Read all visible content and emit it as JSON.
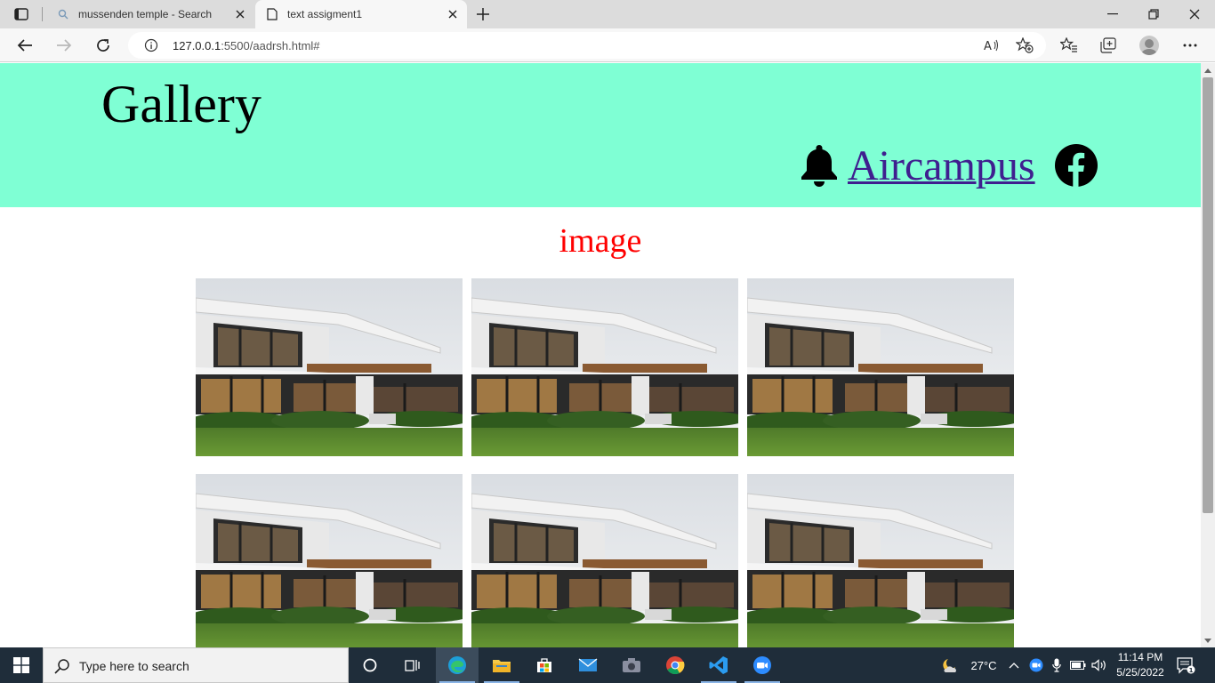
{
  "browser": {
    "tabs": [
      {
        "label": "mussenden temple - Search",
        "icon": "search-icon",
        "active": false
      },
      {
        "label": "text assigment1",
        "icon": "page-icon",
        "active": true
      }
    ],
    "address": {
      "host": "127.0.0.1",
      "rest": ":5500/aadrsh.html#"
    }
  },
  "page": {
    "header": {
      "title": "Gallery",
      "link_label": "Aircampus",
      "bg_color": "#7fffd4",
      "link_color": "#3f1f8f"
    },
    "section_title": "image",
    "section_title_color": "#ff0000",
    "images": [
      {
        "alt": "house"
      },
      {
        "alt": "house"
      },
      {
        "alt": "house"
      },
      {
        "alt": "house"
      },
      {
        "alt": "house"
      },
      {
        "alt": "house"
      }
    ]
  },
  "taskbar": {
    "search_placeholder": "Type here to search",
    "weather": "27°C",
    "time": "11:14 PM",
    "date": "5/25/2022",
    "notification_count": "1"
  }
}
